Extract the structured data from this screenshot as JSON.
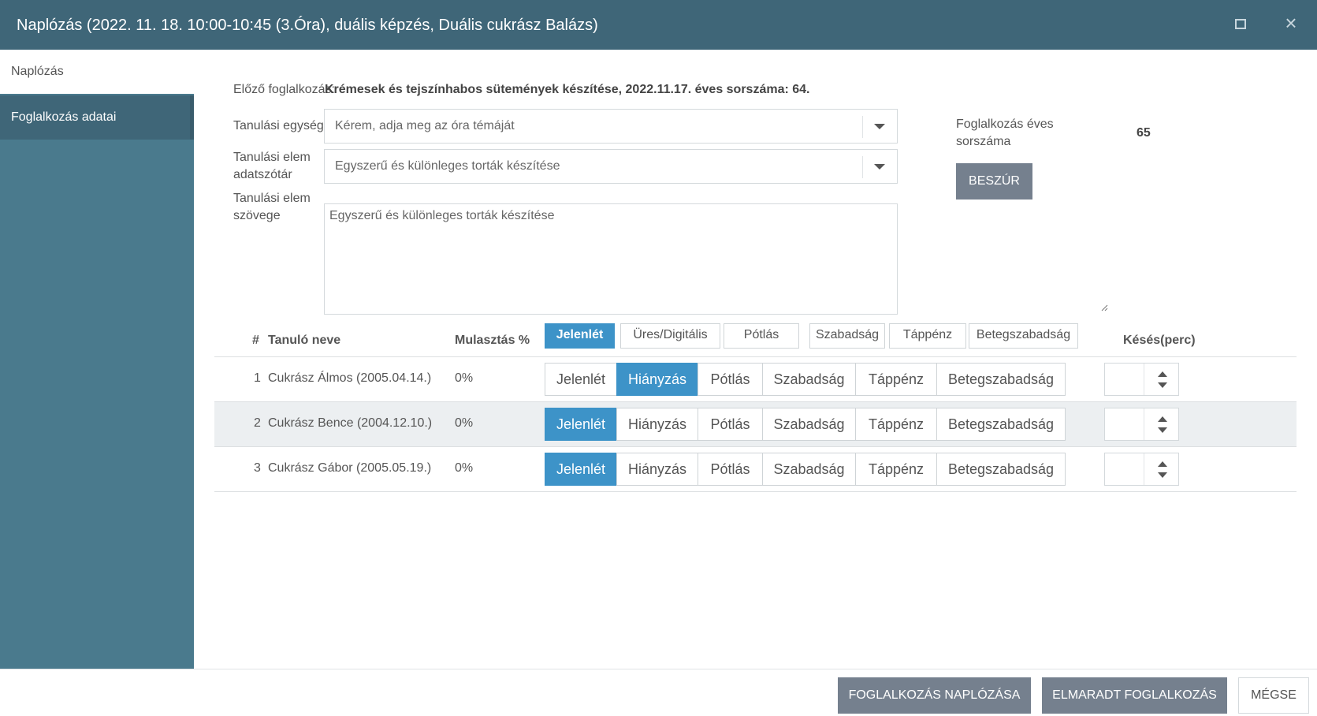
{
  "window": {
    "title": "Naplózás (2022. 11. 18. 10:00-10:45 (3.Óra), duális képzés, Duális cukrász Balázs)"
  },
  "sidebar": {
    "items": [
      {
        "label": "Naplózás"
      },
      {
        "label": "Foglalkozás adatai"
      }
    ]
  },
  "form": {
    "prev_label": "Előző foglalkozás:",
    "prev_value": "Krémesek és tejszínhabos sütemények készítése, 2022.11.17. éves sorszáma: 64.",
    "unit_label": "Tanulási egység",
    "unit_placeholder": "Kérem, adja meg az óra témáját",
    "element_dict_label_1": "Tanulási elem",
    "element_dict_label_2": "adatszótár",
    "element_dict_value": "Egyszerű és különleges torták készítése",
    "element_text_label_1": "Tanulási elem",
    "element_text_label_2": "szövege",
    "element_text_value": "Egyszerű és különleges torták készítése",
    "annual_label": "Foglalkozás éves sorszáma",
    "annual_value": "65",
    "insert_button": "BESZÚR"
  },
  "table": {
    "headers": {
      "num": "#",
      "name": "Tanuló neve",
      "absence": "Mulasztás %",
      "late": "Késés(perc)"
    },
    "bulk_buttons": [
      {
        "label": "Jelenlét",
        "active": true
      },
      {
        "label": "Üres/Digitális",
        "active": false
      },
      {
        "label": "Pótlás",
        "active": false
      },
      {
        "label": "Szabadság",
        "active": false
      },
      {
        "label": "Táppénz",
        "active": false
      },
      {
        "label": "Betegszabadság",
        "active": false
      }
    ],
    "status_options": [
      "Jelenlét",
      "Hiányzás",
      "Pótlás",
      "Szabadság",
      "Táppénz",
      "Betegszabadság"
    ],
    "rows": [
      {
        "num": "1",
        "name": "Cukrász Álmos (2005.04.14.)",
        "absence": "0%",
        "selected": "Hiányzás",
        "late": ""
      },
      {
        "num": "2",
        "name": "Cukrász Bence (2004.12.10.)",
        "absence": "0%",
        "selected": "Jelenlét",
        "late": ""
      },
      {
        "num": "3",
        "name": "Cukrász Gábor (2005.05.19.)",
        "absence": "0%",
        "selected": "Jelenlét",
        "late": ""
      }
    ]
  },
  "footer": {
    "log_button": "FOGLALKOZÁS NAPLÓZÁSA",
    "missed_button": "ELMARADT FOGLALKOZÁS",
    "cancel_button": "MÉGSE"
  }
}
